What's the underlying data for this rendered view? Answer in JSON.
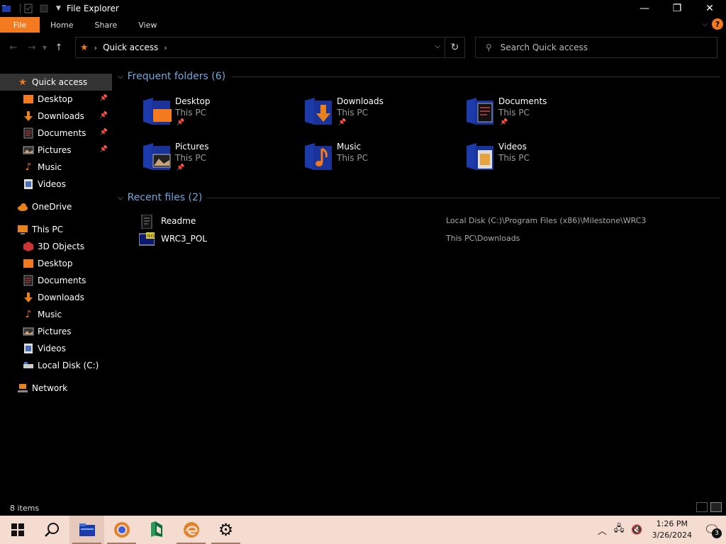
{
  "window": {
    "title": "File Explorer",
    "min_glyph": "—",
    "max_glyph": "❐",
    "close_glyph": "✕"
  },
  "ribbon": {
    "tabs": [
      "File",
      "Home",
      "Share",
      "View"
    ]
  },
  "nav": {
    "breadcrumb": "Quick access",
    "search_placeholder": "Search Quick access"
  },
  "sidebar": {
    "quick_access": {
      "label": "Quick access",
      "items": [
        {
          "label": "Desktop",
          "pinned": true,
          "icon": "desktop-icon"
        },
        {
          "label": "Downloads",
          "pinned": true,
          "icon": "downloads-icon"
        },
        {
          "label": "Documents",
          "pinned": true,
          "icon": "documents-icon"
        },
        {
          "label": "Pictures",
          "pinned": true,
          "icon": "pictures-icon"
        },
        {
          "label": "Music",
          "pinned": false,
          "icon": "music-icon"
        },
        {
          "label": "Videos",
          "pinned": false,
          "icon": "videos-icon"
        }
      ]
    },
    "onedrive": "OneDrive",
    "this_pc": {
      "label": "This PC",
      "items": [
        "3D Objects",
        "Desktop",
        "Documents",
        "Downloads",
        "Music",
        "Pictures",
        "Videos",
        "Local Disk (C:)"
      ]
    },
    "network": "Network"
  },
  "frequent": {
    "title": "Frequent folders (6)",
    "folders": [
      {
        "name": "Desktop",
        "location": "This PC",
        "pinned": true
      },
      {
        "name": "Downloads",
        "location": "This PC",
        "pinned": true
      },
      {
        "name": "Documents",
        "location": "This PC",
        "pinned": true
      },
      {
        "name": "Pictures",
        "location": "This PC",
        "pinned": true
      },
      {
        "name": "Music",
        "location": "This PC",
        "pinned": false
      },
      {
        "name": "Videos",
        "location": "This PC",
        "pinned": false
      }
    ]
  },
  "recent": {
    "title": "Recent files (2)",
    "files": [
      {
        "name": "Readme",
        "path": "Local Disk (C:)\\Program Files (x86)\\Milestone\\WRC3"
      },
      {
        "name": "WRC3_POL",
        "path": "This PC\\Downloads"
      }
    ]
  },
  "status": {
    "count": "8 items"
  },
  "taskbar": {
    "time": "1:26 PM",
    "date": "3/26/2024",
    "notifications": "3"
  },
  "colors": {
    "accent": "#f37a1f",
    "folder_blue": "#1c3aa9",
    "taskbar": "#f4dcd0"
  }
}
